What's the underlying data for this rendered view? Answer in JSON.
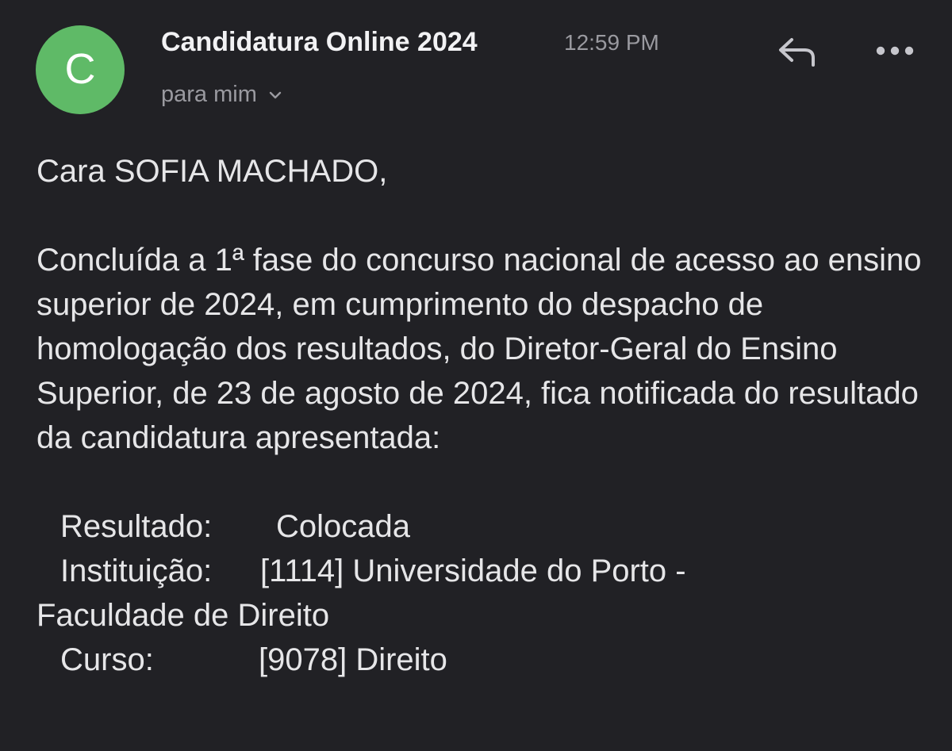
{
  "header": {
    "avatar_letter": "C",
    "sender": "Candidatura Online 2024",
    "time": "12:59 PM",
    "recipient": "para mim",
    "avatar_color": "#5fba67"
  },
  "message": {
    "greeting": "Cara SOFIA MACHADO,",
    "paragraph": "Concluída a 1ª fase do concurso nacional de acesso ao ensino superior de 2024, em cumprimento do despacho de homologação dos resultados, do Diretor-Geral do Ensino Superior, de 23 de agosto de 2024, fica notificada do resultado da candidatura apresentada:",
    "details": {
      "result_label": "Resultado:",
      "result_value": "Colocada",
      "institution_label": "Instituição:",
      "institution_value_line1": "[1114] Universidade do Porto -",
      "institution_value_line2": "Faculdade de Direito",
      "course_label": "Curso:",
      "course_value": "[9078] Direito"
    }
  },
  "icons": {
    "reply": "reply-icon",
    "more": "more-horizontal-icon",
    "chevron": "chevron-down-icon"
  }
}
